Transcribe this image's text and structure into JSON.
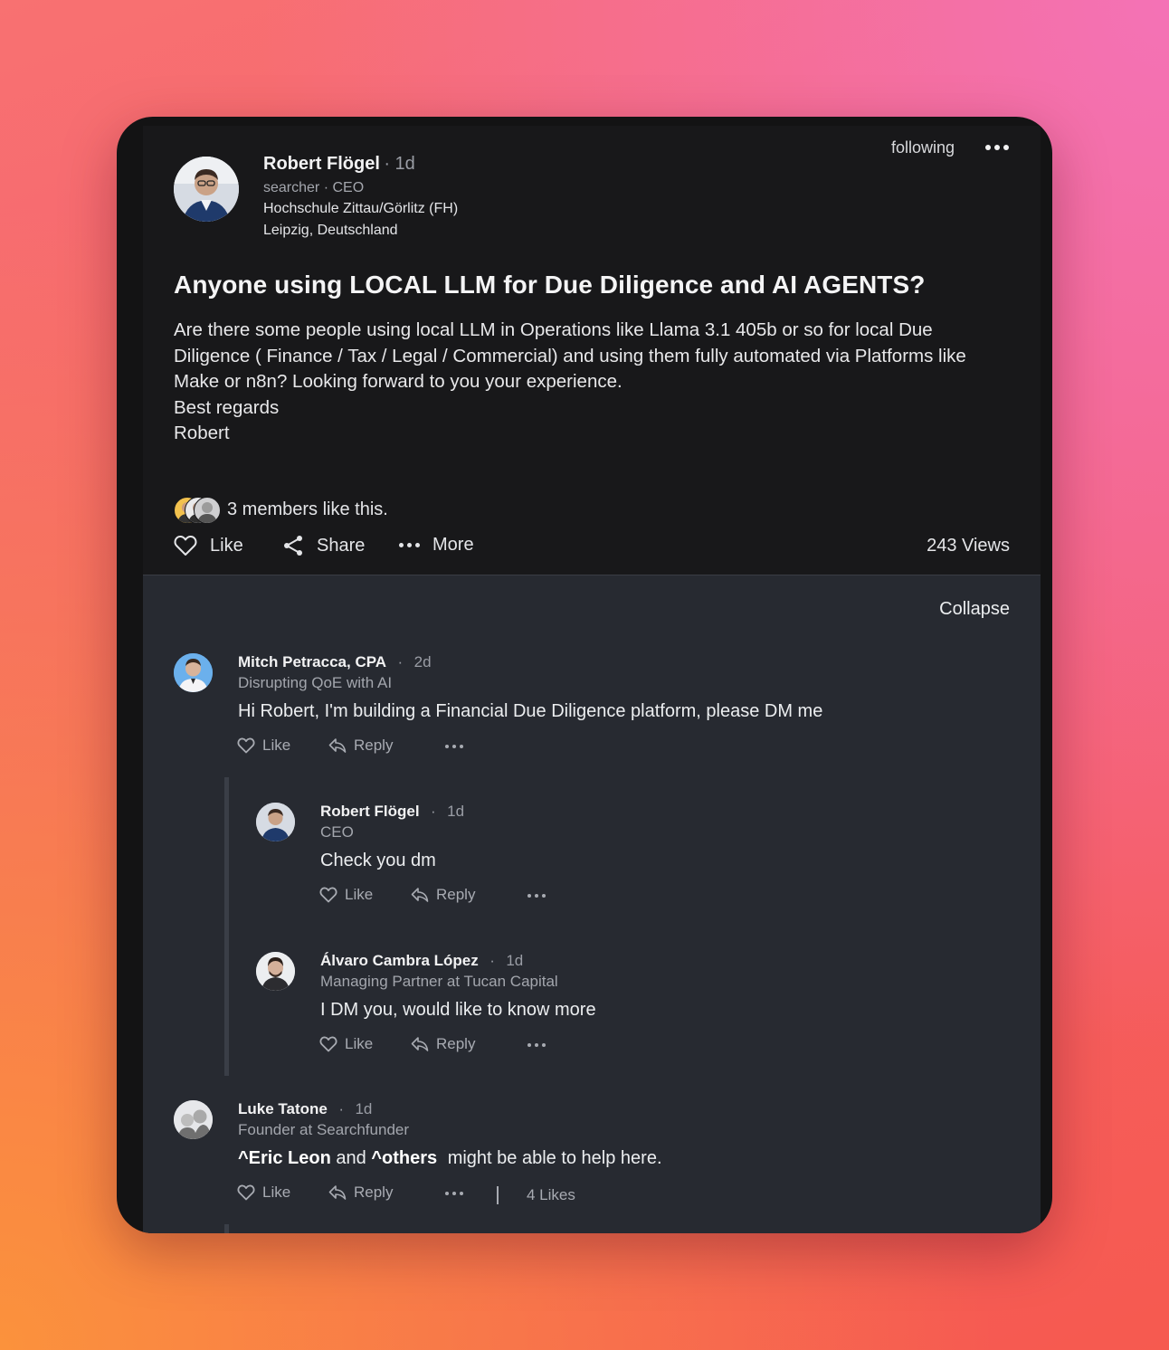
{
  "post": {
    "author": "Robert Flögel",
    "time": "· 1d",
    "role": "searcher · CEO",
    "school": "Hochschule Zittau/Görlitz (FH)",
    "location": "Leipzig, Deutschland",
    "following_label": "following",
    "title": "Anyone using LOCAL LLM for Due Diligence and AI AGENTS?",
    "body_lines": [
      "Are there some people using local LLM in Operations like Llama 3.1 405b or so for local Due",
      "Diligence ( Finance / Tax / Legal / Commercial) and using them fully automated via Platforms like",
      "Make or n8n? Looking forward to you your experience.",
      "Best regards",
      "Robert"
    ],
    "likes_text": "3 members like this.",
    "actions": {
      "like": "Like",
      "share": "Share",
      "more": "More"
    },
    "views": "243 Views"
  },
  "comments_section": {
    "collapse_label": "Collapse",
    "comments": [
      {
        "name": "Mitch Petracca, CPA",
        "time": "2d",
        "subtitle": "Disrupting QoE with AI",
        "text": "Hi Robert, I'm building a Financial Due Diligence platform, please DM me",
        "like": "Like",
        "reply": "Reply"
      },
      {
        "name": "Robert Flögel",
        "time": "1d",
        "subtitle": "CEO",
        "text": "Check you dm",
        "like": "Like",
        "reply": "Reply"
      },
      {
        "name": "Álvaro Cambra López",
        "time": "1d",
        "subtitle": "Managing Partner at Tucan Capital",
        "text": "I DM you, would like to know more",
        "like": "Like",
        "reply": "Reply"
      },
      {
        "name": "Luke Tatone",
        "time": "1d",
        "subtitle": "Founder at Searchfunder",
        "mention1": "^Eric Leon",
        "mid": "and",
        "mention2": "^others",
        "text_rest": "might be able to help here.",
        "like": "Like",
        "reply": "Reply",
        "likes_count": "4 Likes"
      }
    ]
  },
  "colors": {
    "post_bg": "#18181a",
    "comments_bg": "#272a31",
    "text_primary": "#f2f2f3",
    "text_secondary": "#a8abb2"
  },
  "icons": [
    "heart-icon",
    "share-icon",
    "more-dots-icon",
    "reply-icon",
    "avatar"
  ]
}
